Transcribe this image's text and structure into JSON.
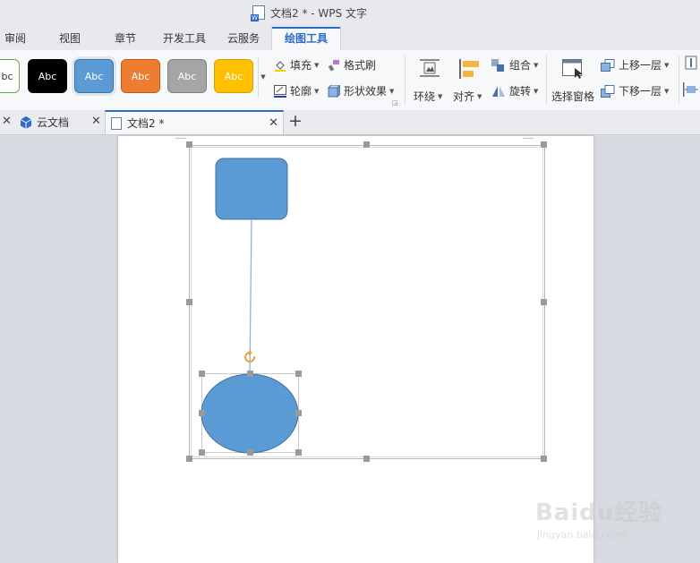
{
  "window": {
    "title": "文档2 * - WPS 文字"
  },
  "menu_tabs": [
    "审阅",
    "视图",
    "章节",
    "开发工具",
    "云服务",
    "绘图工具"
  ],
  "ribbon": {
    "style_swatches": [
      {
        "label": "bc",
        "fill": "#ffffff",
        "border": "#6aa84f",
        "text_color": "#333333"
      },
      {
        "label": "Abc",
        "fill": "#000000",
        "border": "#000000",
        "text_color": "#ffffff"
      },
      {
        "label": "Abc",
        "fill": "#5b9bd5",
        "border": "#41719c",
        "text_color": "#ffffff"
      },
      {
        "label": "Abc",
        "fill": "#ed7d31",
        "border": "#c55a11",
        "text_color": "#ffffff"
      },
      {
        "label": "Abc",
        "fill": "#a5a5a5",
        "border": "#7f7f7f",
        "text_color": "#ffffff"
      },
      {
        "label": "Abc",
        "fill": "#ffc000",
        "border": "#d5a000",
        "text_color": "#ffffff"
      }
    ],
    "fill_label": "填充",
    "format_painter_label": "格式刷",
    "outline_label": "轮廓",
    "shape_effect_label": "形状效果",
    "wrap_label": "环绕",
    "align_label": "对齐",
    "group_label": "组合",
    "rotate_label": "旋转",
    "selection_pane_label": "选择窗格",
    "bring_forward_label": "上移一层",
    "send_backward_label": "下移一层"
  },
  "doc_tabs": [
    {
      "label": "云文档"
    },
    {
      "label": "文档2 *"
    }
  ],
  "colors": {
    "accent": "#2d6bc8",
    "shape_fill": "#5b9bd5",
    "shape_border": "#41719c",
    "rotate_handle": "#f0a030"
  },
  "watermark": {
    "logo": "Baidu经验",
    "url": "jingyan.baidu.com"
  }
}
